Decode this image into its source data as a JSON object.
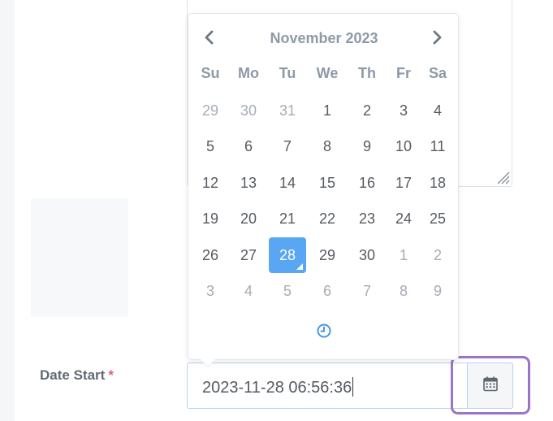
{
  "form": {
    "date_start_label": "Date Start",
    "required_marker": "*",
    "date_start_value": "2023-11-28 06:56:36"
  },
  "datepicker": {
    "month_title": "November 2023",
    "weekdays": [
      "Su",
      "Mo",
      "Tu",
      "We",
      "Th",
      "Fr",
      "Sa"
    ],
    "weeks": [
      [
        {
          "d": "29",
          "m": true
        },
        {
          "d": "30",
          "m": true
        },
        {
          "d": "31",
          "m": true
        },
        {
          "d": "1"
        },
        {
          "d": "2"
        },
        {
          "d": "3"
        },
        {
          "d": "4"
        }
      ],
      [
        {
          "d": "5"
        },
        {
          "d": "6"
        },
        {
          "d": "7"
        },
        {
          "d": "8"
        },
        {
          "d": "9"
        },
        {
          "d": "10"
        },
        {
          "d": "11"
        }
      ],
      [
        {
          "d": "12"
        },
        {
          "d": "13"
        },
        {
          "d": "14"
        },
        {
          "d": "15"
        },
        {
          "d": "16"
        },
        {
          "d": "17"
        },
        {
          "d": "18"
        }
      ],
      [
        {
          "d": "19"
        },
        {
          "d": "20"
        },
        {
          "d": "21"
        },
        {
          "d": "22"
        },
        {
          "d": "23"
        },
        {
          "d": "24"
        },
        {
          "d": "25"
        }
      ],
      [
        {
          "d": "26"
        },
        {
          "d": "27"
        },
        {
          "d": "28",
          "active": true
        },
        {
          "d": "29"
        },
        {
          "d": "30"
        },
        {
          "d": "1",
          "m": true
        },
        {
          "d": "2",
          "m": true
        }
      ],
      [
        {
          "d": "3",
          "m": true
        },
        {
          "d": "4",
          "m": true
        },
        {
          "d": "5",
          "m": true
        },
        {
          "d": "6",
          "m": true
        },
        {
          "d": "7",
          "m": true
        },
        {
          "d": "8",
          "m": true
        },
        {
          "d": "9",
          "m": true
        }
      ]
    ],
    "selected_date": "28",
    "icons": {
      "prev": "chevron-left-icon",
      "next": "chevron-right-icon",
      "time": "clock-icon",
      "addon": "calendar-icon"
    }
  },
  "colors": {
    "accent": "#59a6f2",
    "header_text": "#8d9aa6",
    "muted_day": "#a5adb6",
    "required": "#e0607e",
    "focus_highlight": "#9b74c8"
  }
}
